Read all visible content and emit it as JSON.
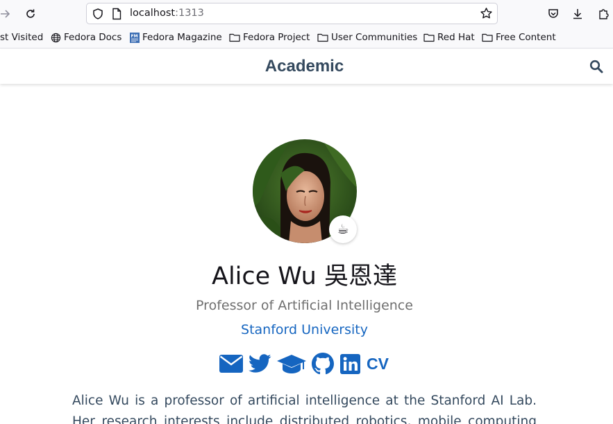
{
  "browser": {
    "url_host": "localhost",
    "url_port": ":1313",
    "bookmarks": [
      {
        "label": "st Visited",
        "icon": "none"
      },
      {
        "label": "Fedora Docs",
        "icon": "globe-icon"
      },
      {
        "label": "Fedora Magazine",
        "icon": "fedora-magazine-icon"
      },
      {
        "label": "Fedora Project",
        "icon": "folder-icon"
      },
      {
        "label": "User Communities",
        "icon": "folder-icon"
      },
      {
        "label": "Red Hat",
        "icon": "folder-icon"
      },
      {
        "label": "Free Content",
        "icon": "folder-icon"
      }
    ]
  },
  "site": {
    "brand": "Academic"
  },
  "profile": {
    "name": "Alice Wu 吳恩達",
    "role": "Professor of Artificial Intelligence",
    "organization": "Stanford University",
    "status_emoji": "☕",
    "cv_label": "CV",
    "bio": "Alice Wu is a professor of artificial intelligence at the Stanford AI Lab. Her research interests include distributed robotics, mobile computing"
  },
  "colors": {
    "accent": "#1565c0",
    "heading": "#34495e"
  }
}
